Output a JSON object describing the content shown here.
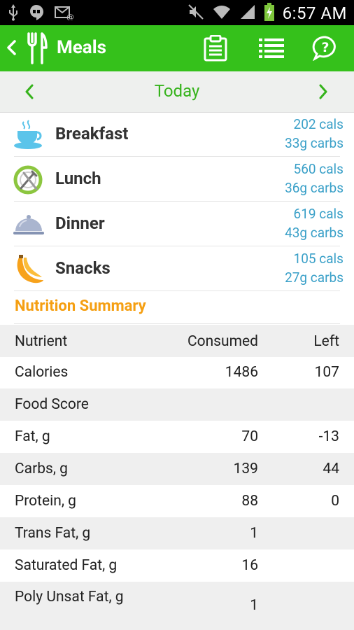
{
  "status_bar": {
    "time": "6:57 AM"
  },
  "app_bar": {
    "title": "Meals"
  },
  "day_nav": {
    "label": "Today"
  },
  "meals": [
    {
      "name": "Breakfast",
      "cals": "202 cals",
      "carbs": "33g carbs",
      "icon": "coffee-cup-icon"
    },
    {
      "name": "Lunch",
      "cals": "560 cals",
      "carbs": "36g carbs",
      "icon": "plate-fork-knife-icon"
    },
    {
      "name": "Dinner",
      "cals": "619 cals",
      "carbs": "43g carbs",
      "icon": "cloche-icon"
    },
    {
      "name": "Snacks",
      "cals": "105 cals",
      "carbs": "27g carbs",
      "icon": "banana-icon"
    }
  ],
  "nutrition_summary": {
    "title": "Nutrition Summary",
    "headers": [
      "Nutrient",
      "Consumed",
      "Left"
    ],
    "rows": [
      {
        "nutrient": "Calories",
        "consumed": "1486",
        "left": "107"
      },
      {
        "nutrient": "Food Score",
        "consumed": "",
        "left": ""
      },
      {
        "nutrient": "Fat, g",
        "consumed": "70",
        "left": "-13"
      },
      {
        "nutrient": "Carbs, g",
        "consumed": "139",
        "left": "44"
      },
      {
        "nutrient": "Protein, g",
        "consumed": "88",
        "left": "0"
      },
      {
        "nutrient": "Trans Fat, g",
        "consumed": "1",
        "left": ""
      },
      {
        "nutrient": "Saturated Fat, g",
        "consumed": "16",
        "left": ""
      },
      {
        "nutrient": "Poly Unsat Fat, g",
        "consumed": "1",
        "left": ""
      }
    ]
  },
  "colors": {
    "app_bar": "#35c11b",
    "accent_green": "#35b31b",
    "link_blue": "#3aa0c8",
    "section_orange": "#f59f12"
  }
}
